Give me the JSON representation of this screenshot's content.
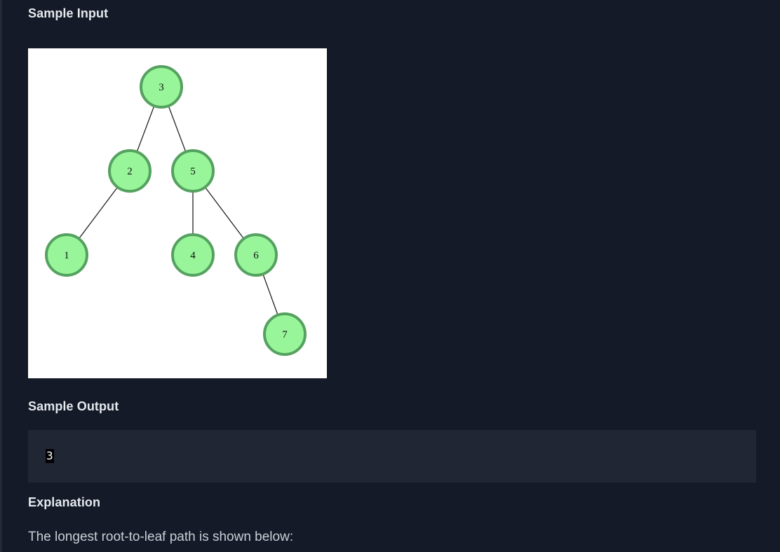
{
  "sections": {
    "sample_input_heading": "Sample Input",
    "sample_output_heading": "Sample Output",
    "explanation_heading": "Explanation"
  },
  "tree": {
    "nodes": [
      {
        "id": "3",
        "label": "3"
      },
      {
        "id": "2",
        "label": "2"
      },
      {
        "id": "5",
        "label": "5"
      },
      {
        "id": "1",
        "label": "1"
      },
      {
        "id": "4",
        "label": "4"
      },
      {
        "id": "6",
        "label": "6"
      },
      {
        "id": "7",
        "label": "7"
      }
    ],
    "edges": [
      [
        "3",
        "2"
      ],
      [
        "3",
        "5"
      ],
      [
        "2",
        "1"
      ],
      [
        "5",
        "4"
      ],
      [
        "5",
        "6"
      ],
      [
        "6",
        "7"
      ]
    ],
    "colors": {
      "node_fill": "#98f59a",
      "node_stroke": "#55a160",
      "edge": "#222222"
    }
  },
  "sample_output": {
    "value": "3"
  },
  "explanation": {
    "text": "The longest root-to-leaf path is shown below:"
  },
  "theme": {
    "background": "#141a27",
    "code_background": "#202633",
    "heading_color": "#e6e9ee",
    "text_color": "#c9ced6"
  }
}
